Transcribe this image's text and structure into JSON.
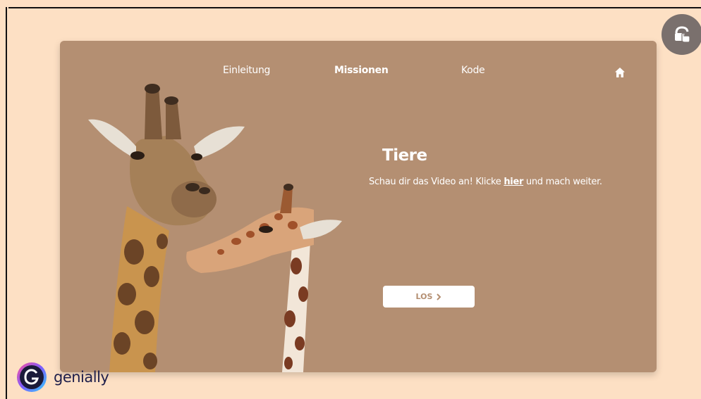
{
  "nav": {
    "items": [
      {
        "label": "Einleitung",
        "active": false
      },
      {
        "label": "Missionen",
        "active": true
      },
      {
        "label": "Kode",
        "active": false
      }
    ],
    "home_icon": "home-icon"
  },
  "content": {
    "title": "Tiere",
    "subtitle_before": "Schau dir das Video an! Klicke ",
    "subtitle_link": "hier",
    "subtitle_after": " und mach weiter.",
    "button_label": "LOS",
    "button_icon": "chevron-right-icon"
  },
  "overlay": {
    "lock_icon": "unlock-touch-icon"
  },
  "branding": {
    "name": "genially",
    "logo_icon": "genially-logo-icon"
  },
  "colors": {
    "background": "#fde0c4",
    "card": "#b48f72",
    "button_text": "#b48f72",
    "lock_button": "#7a706d",
    "brand_text": "#1e1e4a"
  }
}
